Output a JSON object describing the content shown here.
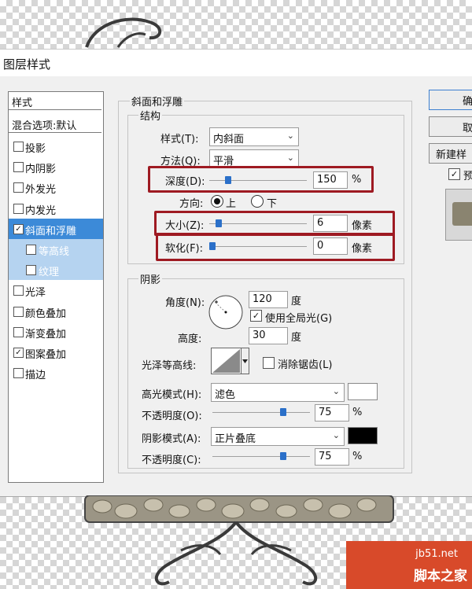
{
  "dialog": {
    "title": "图层样式"
  },
  "left_panel": {
    "styles_header": "样式",
    "blend_header": "混合选项:默认",
    "items": [
      {
        "label": "投影",
        "checked": false
      },
      {
        "label": "内阴影",
        "checked": false
      },
      {
        "label": "外发光",
        "checked": false
      },
      {
        "label": "内发光",
        "checked": false
      },
      {
        "label": "斜面和浮雕",
        "checked": true,
        "selected": true
      },
      {
        "label": "等高线",
        "checked": false,
        "sub": true
      },
      {
        "label": "纹理",
        "checked": false,
        "sub": true
      },
      {
        "label": "光泽",
        "checked": false
      },
      {
        "label": "颜色叠加",
        "checked": false
      },
      {
        "label": "渐变叠加",
        "checked": false
      },
      {
        "label": "图案叠加",
        "checked": true
      },
      {
        "label": "描边",
        "checked": false
      }
    ]
  },
  "bevel": {
    "group_title": "斜面和浮雕",
    "structure_title": "结构",
    "style_label": "样式(T):",
    "style_value": "内斜面",
    "technique_label": "方法(Q):",
    "technique_value": "平滑",
    "depth_label": "深度(D):",
    "depth_value": "150",
    "depth_unit": "%",
    "direction_label": "方向:",
    "direction_up": "上",
    "direction_down": "下",
    "size_label": "大小(Z):",
    "size_value": "6",
    "size_unit": "像素",
    "soften_label": "软化(F):",
    "soften_value": "0",
    "soften_unit": "像素"
  },
  "shading": {
    "title": "阴影",
    "angle_label": "角度(N):",
    "angle_value": "120",
    "angle_unit": "度",
    "global_light_label": "使用全局光(G)",
    "altitude_label": "高度:",
    "altitude_value": "30",
    "altitude_unit": "度",
    "gloss_label": "光泽等高线:",
    "antialias_label": "消除锯齿(L)",
    "highlight_mode_label": "高光模式(H):",
    "highlight_mode_value": "滤色",
    "highlight_opacity_label": "不透明度(O):",
    "highlight_opacity_value": "75",
    "highlight_opacity_unit": "%",
    "shadow_mode_label": "阴影模式(A):",
    "shadow_mode_value": "正片叠底",
    "shadow_opacity_label": "不透明度(C):",
    "shadow_opacity_value": "75",
    "shadow_opacity_unit": "%",
    "highlight_color": "#ffffff",
    "shadow_color": "#000000"
  },
  "right_buttons": {
    "ok": "确",
    "cancel": "取",
    "new_style": "新建样",
    "preview": "预"
  },
  "watermark": {
    "site": "jb51.net",
    "name": "脚本之家"
  },
  "colors": {
    "highlight_box": "#9e1a22",
    "selected_item": "#3c8ad8",
    "slider_thumb": "#2b70c9"
  }
}
